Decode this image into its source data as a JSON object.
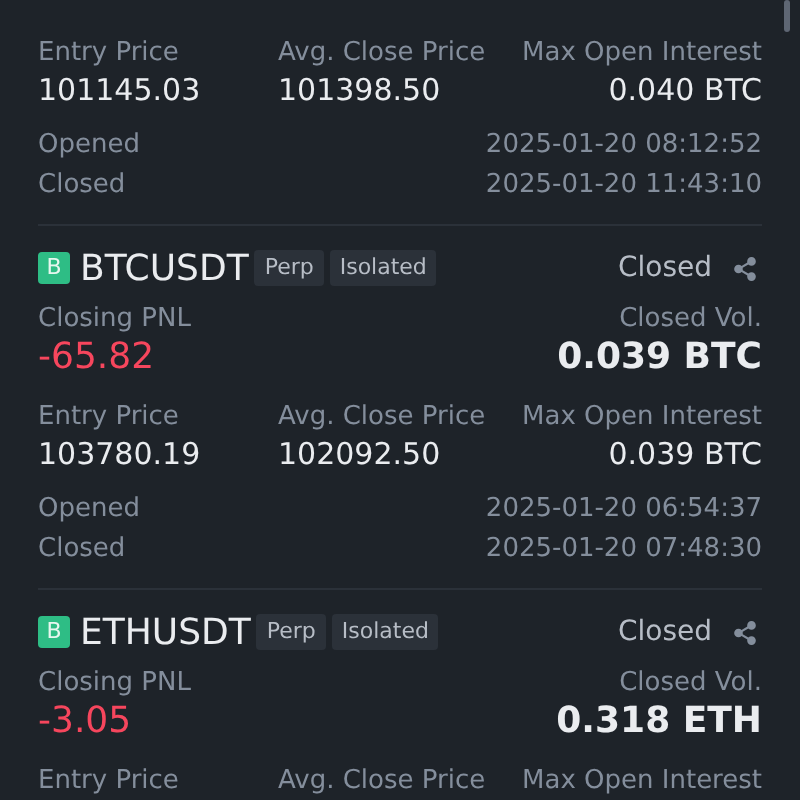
{
  "positions": [
    {
      "entry_label": "Entry Price",
      "entry_price": "101145.03",
      "avg_close_label": "Avg. Close Price",
      "avg_close_price": "101398.50",
      "max_oi_label": "Max Open Interest",
      "max_oi": "0.040 BTC",
      "opened_label": "Opened",
      "opened": "2025-01-20 08:12:52",
      "closed_label": "Closed",
      "closed": "2025-01-20 11:43:10"
    },
    {
      "badge": "B",
      "symbol": "BTCUSDT",
      "tags": [
        "Perp",
        "Isolated"
      ],
      "status": "Closed",
      "pnl_label": "Closing PNL",
      "pnl": "-65.82",
      "pnl_positive": false,
      "vol_label": "Closed Vol.",
      "vol": "0.039 BTC",
      "entry_label": "Entry Price",
      "entry_price": "103780.19",
      "avg_close_label": "Avg. Close Price",
      "avg_close_price": "102092.50",
      "max_oi_label": "Max Open Interest",
      "max_oi": "0.039 BTC",
      "opened_label": "Opened",
      "opened": "2025-01-20 06:54:37",
      "closed_label": "Closed",
      "closed": "2025-01-20 07:48:30"
    },
    {
      "badge": "B",
      "symbol": "ETHUSDT",
      "tags": [
        "Perp",
        "Isolated"
      ],
      "status": "Closed",
      "pnl_label": "Closing PNL",
      "pnl": "-3.05",
      "pnl_positive": false,
      "vol_label": "Closed Vol.",
      "vol": "0.318 ETH",
      "entry_label": "Entry Price",
      "avg_close_label": "Avg. Close Price",
      "max_oi_label": "Max Open Interest"
    }
  ]
}
